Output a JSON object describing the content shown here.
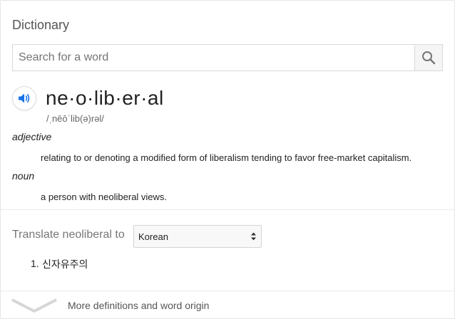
{
  "dictionary": {
    "heading": "Dictionary",
    "search": {
      "placeholder": "Search for a word"
    },
    "entry": {
      "headword": "ne·o·lib·er·al",
      "pronunciation": "/ˌnēōˈlib(ə)rəl/",
      "senses": [
        {
          "part_of_speech": "adjective",
          "definition": "relating to or denoting a modified form of liberalism tending to favor free-market capitalism."
        },
        {
          "part_of_speech": "noun",
          "definition": "a person with neoliberal views."
        }
      ]
    },
    "translate": {
      "label": "Translate neoliberal to",
      "selected_language": "Korean",
      "results": [
        {
          "number": "1.",
          "text": "신자유주의"
        }
      ]
    },
    "more": {
      "label": "More definitions and word origin"
    }
  },
  "colors": {
    "accent_blue": "#1a73e8",
    "icon_gray": "#757575",
    "border": "#d9d9d9"
  },
  "icons": {
    "search": "search-icon",
    "speaker": "speaker-icon",
    "select": "updown-arrows-icon",
    "expand": "chevron-down-icon"
  }
}
